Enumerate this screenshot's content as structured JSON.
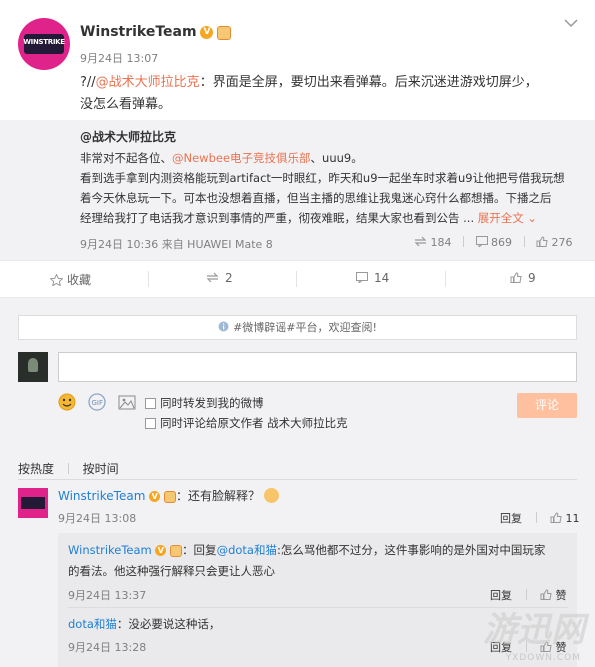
{
  "post": {
    "author": "WinstrikeTeam",
    "avatar_text": "WINSTRIKE",
    "timestamp": "9月24日 13:07",
    "text_prefix": "?//",
    "text_mention": "@战术大师拉比克",
    "text_line1": "：界面是全屏，要切出来看弹幕。后来沉迷进游戏切屏少，",
    "text_line2": "没怎么看弹幕。"
  },
  "repost": {
    "author": "@战术大师拉比克",
    "line1_a": "非常对不起各位、",
    "line1_mention": "@Newbee电子竞技俱乐部",
    "line1_b": "、uuu9。",
    "line2": "看到选手拿到内测资格能玩到artifact一时眼红，昨天和u9一起坐车时求着u9让他把号借我玩想",
    "line3": "着今天休息玩一下。可本也没想着直播，但当主播的思维让我鬼迷心窍什么都想播。下播之后",
    "line4": "经理给我打了电话我才意识到事情的严重，彻夜难眠，结果大家也看到公告 ...",
    "expand": "展开全文 ⌄",
    "meta": "9月24日 10:36 来自 HUAWEI Mate 8",
    "reposts": "184",
    "comments": "869",
    "likes": "276"
  },
  "actions": {
    "collect": "收藏",
    "repost": "2",
    "comment": "14",
    "like": "9"
  },
  "comment_box": {
    "notice": "#微博辟谣#平台，欢迎查阅!",
    "opt1": "同时转发到我的微博",
    "opt2": "同时评论给原文作者 战术大师拉比克",
    "submit": "评论"
  },
  "sort": {
    "hot": "按热度",
    "time": "按时间"
  },
  "comments": [
    {
      "author": "WinstrikeTeam",
      "text": "：还有脸解释？",
      "time": "9月24日 13:08",
      "reply": "回复",
      "likes": "11"
    }
  ],
  "replies": [
    {
      "author": "WinstrikeTeam",
      "prefix": "：回复",
      "mention": "@dota和猫",
      "text1": ":怎么骂他都不过分，这件事影响的是外国对中国玩家",
      "text2": "的看法。他这种强行解释只会更让人恶心",
      "time": "9月24日 13:37",
      "reply": "回复",
      "like": "赞"
    },
    {
      "author": "dota和猫",
      "text": "：没必要说这种话，",
      "time": "9月24日 13:28",
      "reply": "回复",
      "like": "赞"
    }
  ],
  "watermark": {
    "main": "游迅网",
    "sub": "YXDOWN.COM"
  }
}
